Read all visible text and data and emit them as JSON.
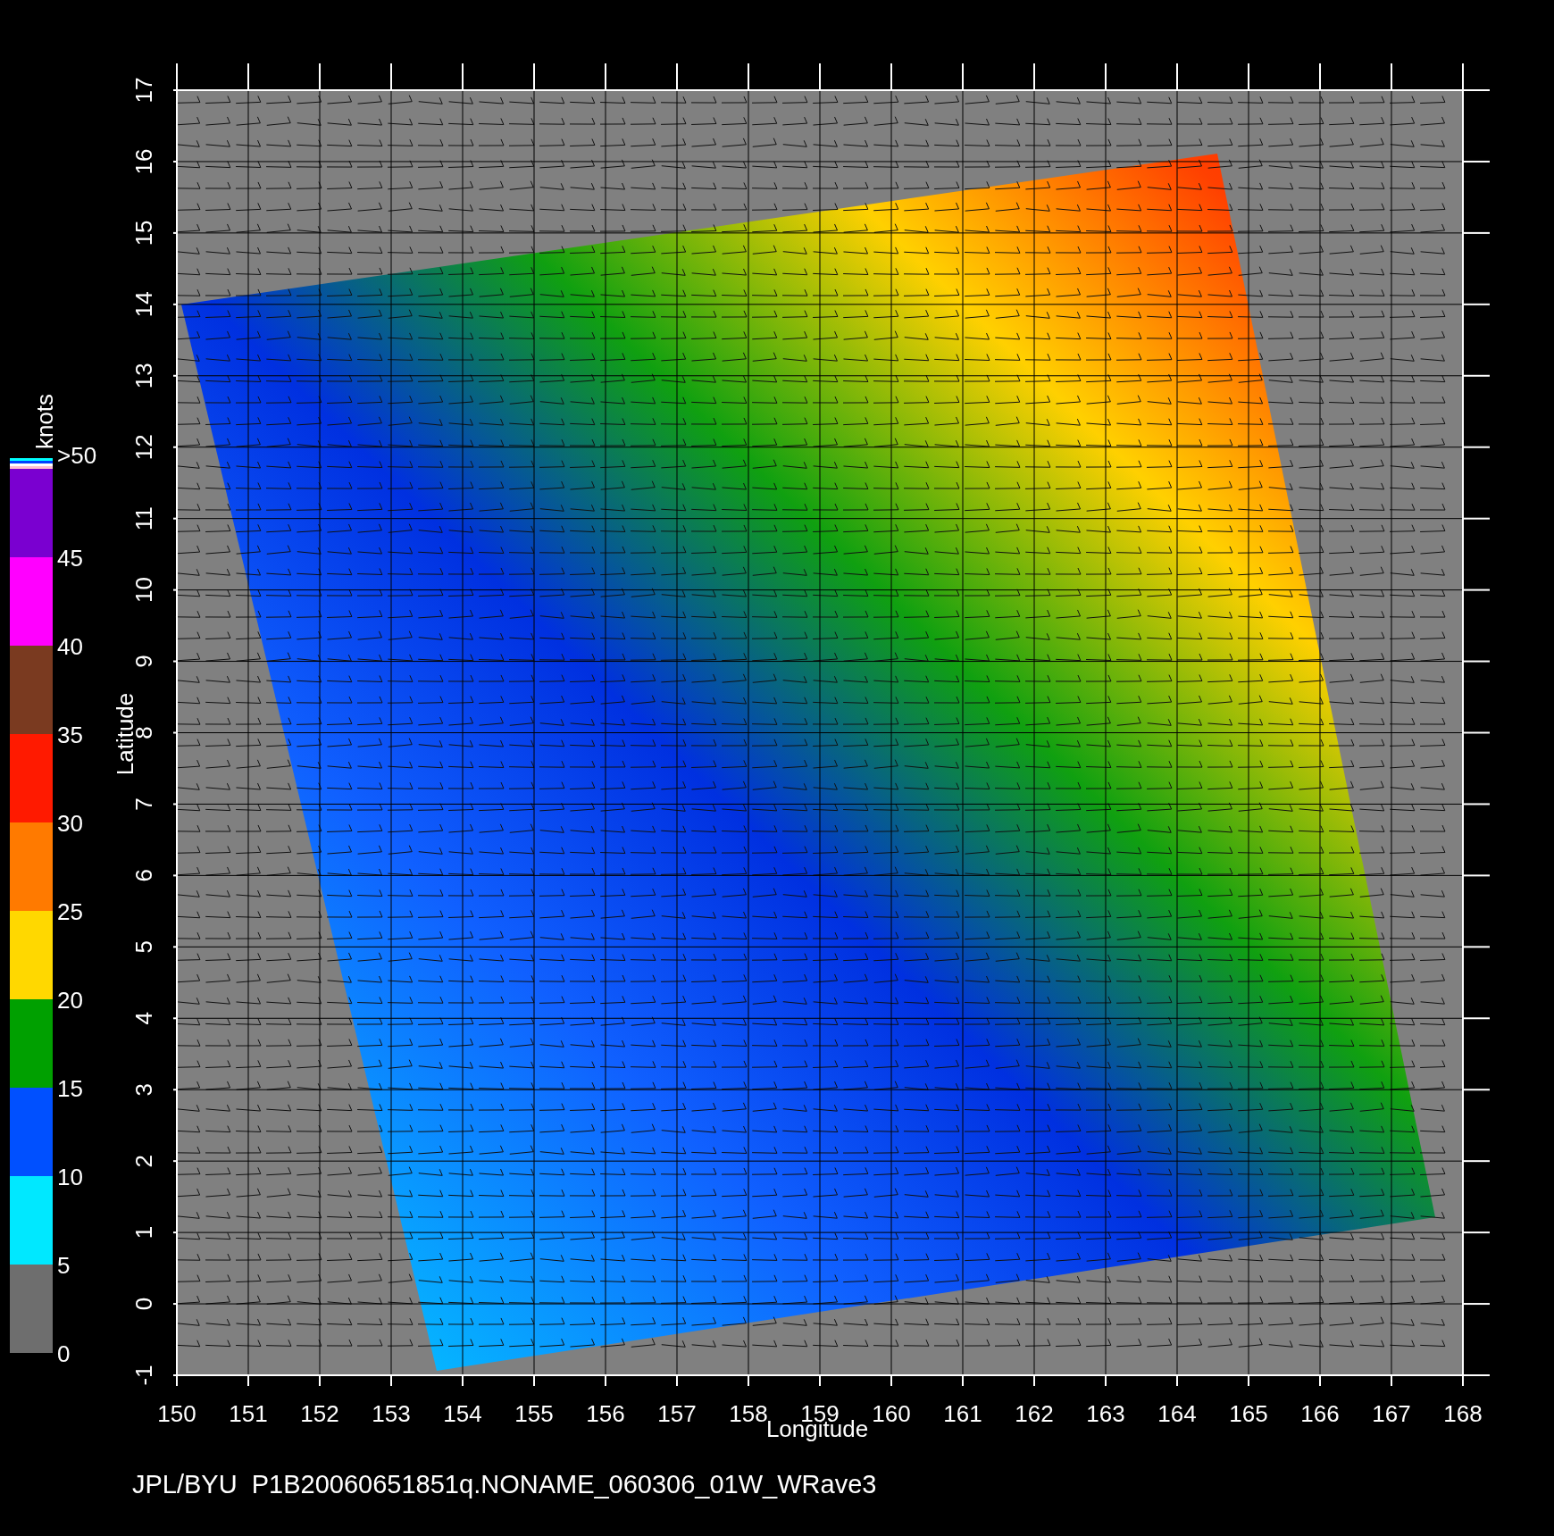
{
  "plot": {
    "x_axis": {
      "label": "Longitude",
      "ticks": [
        "150",
        "151",
        "152",
        "153",
        "154",
        "155",
        "156",
        "157",
        "158",
        "159",
        "160",
        "161",
        "162",
        "163",
        "164",
        "165",
        "166",
        "167",
        "168"
      ]
    },
    "y_axis": {
      "label": "Latitude",
      "ticks": [
        "-1",
        "0",
        "1",
        "2",
        "3",
        "4",
        "5",
        "6",
        "7",
        "8",
        "9",
        "10",
        "11",
        "12",
        "13",
        "14",
        "15",
        "16",
        "17"
      ]
    }
  },
  "colorbar": {
    "title": "knots",
    "labels": [
      ">50",
      "45",
      "40",
      "35",
      "30",
      "25",
      "20",
      "15",
      "10",
      "5",
      "0"
    ],
    "segments": [
      {
        "kind": "band",
        "color": "#6e6e6e"
      },
      {
        "kind": "band",
        "color": "#00e8ff"
      },
      {
        "kind": "band",
        "color": "#0050ff"
      },
      {
        "kind": "band",
        "color": "#00a000"
      },
      {
        "kind": "band",
        "color": "#ffd800"
      },
      {
        "kind": "band",
        "color": "#ff7a00"
      },
      {
        "kind": "band",
        "color": "#ff1a00"
      },
      {
        "kind": "band",
        "color": "#7a3a20"
      },
      {
        "kind": "band",
        "color": "#ff00ff"
      },
      {
        "kind": "band",
        "color": "#7a00d0"
      },
      {
        "kind": "strip",
        "color": "#ffc0d0"
      },
      {
        "kind": "strip",
        "color": "#ffffff"
      },
      {
        "kind": "strip",
        "color": "#0040ff"
      },
      {
        "kind": "strip",
        "color": "#00ffff"
      }
    ]
  },
  "footer": "JPL/BYU  P1B20060651851q.NONAME_060306_01W_WRave3"
}
